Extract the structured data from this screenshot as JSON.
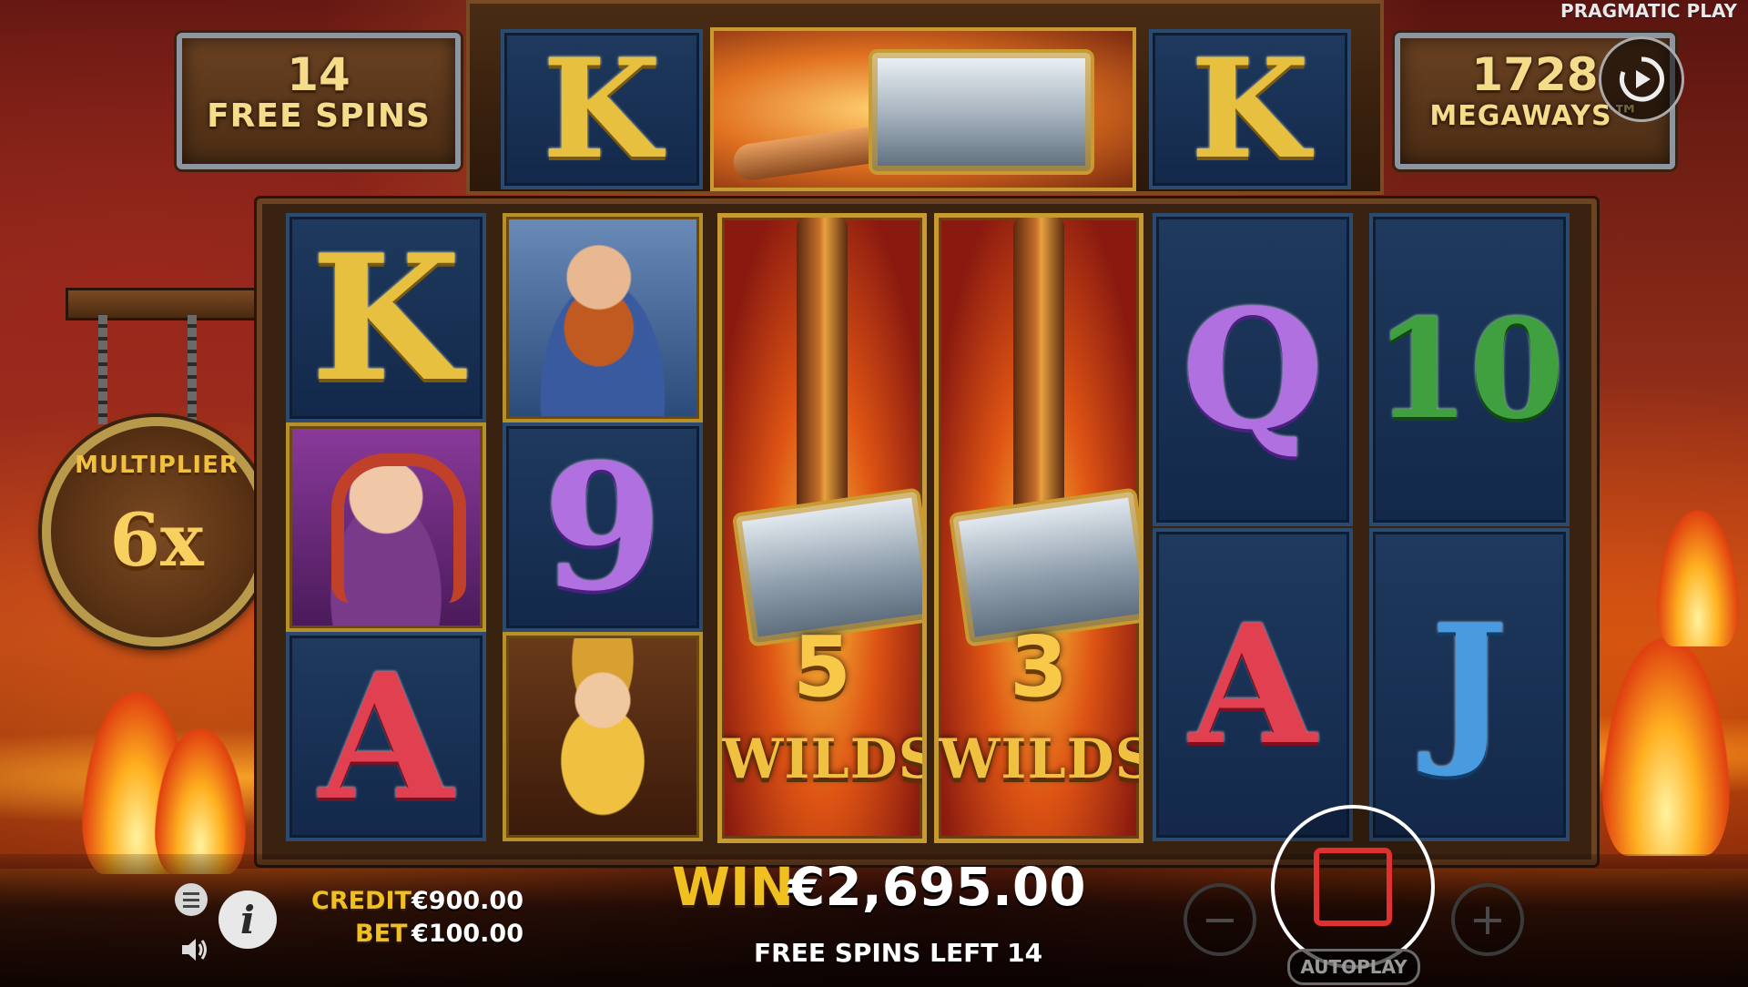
{
  "header": {
    "provider": "PRAGMATIC PLAY",
    "free_spins_count": "14",
    "free_spins_label": "FREE SPINS",
    "ways_count": "1728",
    "ways_label": "MEGAWAYS™"
  },
  "top_reel": {
    "symbols": [
      "K",
      "hammer",
      "K"
    ]
  },
  "multiplier": {
    "label": "MULTIPLIER",
    "value": "6x"
  },
  "reels": [
    {
      "symbols": [
        "K",
        "valkyrie",
        "A"
      ]
    },
    {
      "symbols": [
        "dwarf-warrior",
        "9",
        "thor"
      ]
    },
    {
      "wild_count": "5",
      "wild_label": "WILDS"
    },
    {
      "wild_count": "3",
      "wild_label": "WILDS"
    },
    {
      "symbols": [
        "Q",
        "A"
      ]
    },
    {
      "symbols": [
        "10",
        "J"
      ]
    }
  ],
  "bottom": {
    "credit_label": "CREDIT",
    "credit_value": "€900.00",
    "bet_label": "BET",
    "bet_value": "€100.00",
    "win_label": "WIN",
    "win_value": "€2,695.00",
    "free_spins_left": "FREE SPINS LEFT 14",
    "autoplay_label": "AUTOPLAY",
    "info_glyph": "i",
    "minus_glyph": "−",
    "plus_glyph": "+"
  },
  "colors": {
    "gold": "#f0c020",
    "stop_red": "#e03030"
  }
}
